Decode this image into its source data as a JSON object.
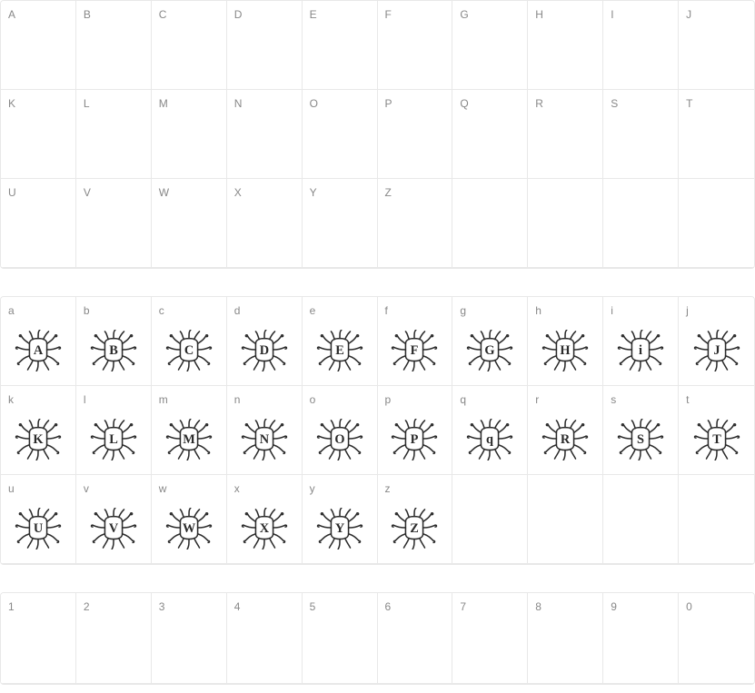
{
  "sections": [
    {
      "id": "uppercase",
      "rows": 3,
      "cells": [
        {
          "label": "A",
          "glyph": ""
        },
        {
          "label": "B",
          "glyph": ""
        },
        {
          "label": "C",
          "glyph": ""
        },
        {
          "label": "D",
          "glyph": ""
        },
        {
          "label": "E",
          "glyph": ""
        },
        {
          "label": "F",
          "glyph": ""
        },
        {
          "label": "G",
          "glyph": ""
        },
        {
          "label": "H",
          "glyph": ""
        },
        {
          "label": "I",
          "glyph": ""
        },
        {
          "label": "J",
          "glyph": ""
        },
        {
          "label": "K",
          "glyph": ""
        },
        {
          "label": "L",
          "glyph": ""
        },
        {
          "label": "M",
          "glyph": ""
        },
        {
          "label": "N",
          "glyph": ""
        },
        {
          "label": "O",
          "glyph": ""
        },
        {
          "label": "P",
          "glyph": ""
        },
        {
          "label": "Q",
          "glyph": ""
        },
        {
          "label": "R",
          "glyph": ""
        },
        {
          "label": "S",
          "glyph": ""
        },
        {
          "label": "T",
          "glyph": ""
        },
        {
          "label": "U",
          "glyph": ""
        },
        {
          "label": "V",
          "glyph": ""
        },
        {
          "label": "W",
          "glyph": ""
        },
        {
          "label": "X",
          "glyph": ""
        },
        {
          "label": "Y",
          "glyph": ""
        },
        {
          "label": "Z",
          "glyph": ""
        },
        {
          "label": "",
          "glyph": ""
        },
        {
          "label": "",
          "glyph": ""
        },
        {
          "label": "",
          "glyph": ""
        },
        {
          "label": "",
          "glyph": ""
        }
      ]
    },
    {
      "id": "lowercase",
      "rows": 3,
      "cells": [
        {
          "label": "a",
          "glyph": "A"
        },
        {
          "label": "b",
          "glyph": "B"
        },
        {
          "label": "c",
          "glyph": "C"
        },
        {
          "label": "d",
          "glyph": "D"
        },
        {
          "label": "e",
          "glyph": "E"
        },
        {
          "label": "f",
          "glyph": "F"
        },
        {
          "label": "g",
          "glyph": "G"
        },
        {
          "label": "h",
          "glyph": "H"
        },
        {
          "label": "i",
          "glyph": "i"
        },
        {
          "label": "j",
          "glyph": "J"
        },
        {
          "label": "k",
          "glyph": "K"
        },
        {
          "label": "l",
          "glyph": "L"
        },
        {
          "label": "m",
          "glyph": "M"
        },
        {
          "label": "n",
          "glyph": "N"
        },
        {
          "label": "o",
          "glyph": "O"
        },
        {
          "label": "p",
          "glyph": "P"
        },
        {
          "label": "q",
          "glyph": "q"
        },
        {
          "label": "r",
          "glyph": "R"
        },
        {
          "label": "s",
          "glyph": "S"
        },
        {
          "label": "t",
          "glyph": "T"
        },
        {
          "label": "u",
          "glyph": "U"
        },
        {
          "label": "v",
          "glyph": "V"
        },
        {
          "label": "w",
          "glyph": "W"
        },
        {
          "label": "x",
          "glyph": "X"
        },
        {
          "label": "y",
          "glyph": "Y"
        },
        {
          "label": "z",
          "glyph": "Z"
        },
        {
          "label": "",
          "glyph": ""
        },
        {
          "label": "",
          "glyph": ""
        },
        {
          "label": "",
          "glyph": ""
        },
        {
          "label": "",
          "glyph": ""
        }
      ]
    },
    {
      "id": "numbers",
      "rows": 1,
      "cells": [
        {
          "label": "1",
          "glyph": ""
        },
        {
          "label": "2",
          "glyph": ""
        },
        {
          "label": "3",
          "glyph": ""
        },
        {
          "label": "4",
          "glyph": ""
        },
        {
          "label": "5",
          "glyph": ""
        },
        {
          "label": "6",
          "glyph": ""
        },
        {
          "label": "7",
          "glyph": ""
        },
        {
          "label": "8",
          "glyph": ""
        },
        {
          "label": "9",
          "glyph": ""
        },
        {
          "label": "0",
          "glyph": ""
        }
      ]
    }
  ]
}
